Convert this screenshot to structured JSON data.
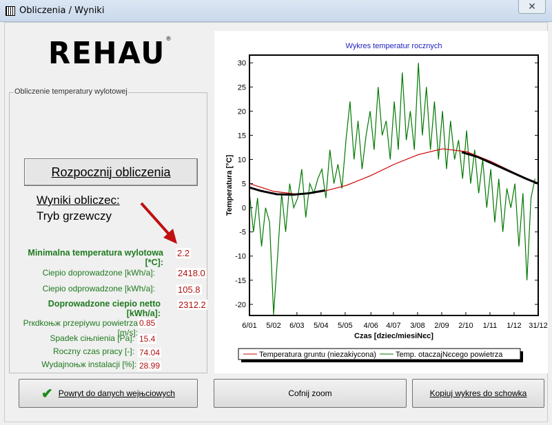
{
  "window": {
    "title": "Obliczenia / Wyniki",
    "close": "✕"
  },
  "logo": "REHAU",
  "group_label": "Obliczenie temperatury wylotowej",
  "start_button": "Rozpocznij obliczenia",
  "results_heading": "Wyniki obliczec:",
  "mode": "Tryb grzewczy",
  "results": [
    {
      "label": "Minimalna temperatura wylotowa [*C]:",
      "value": "2.2"
    },
    {
      "label": "Ciepio doprowadzone [kWh/a]:",
      "value": "2418.0"
    },
    {
      "label": "Ciepio odprowadzone  [kWh/a]:",
      "value": "105.8"
    },
    {
      "label": "Doprowadzone ciepio netto [kWh/a]:",
      "value": "2312.2"
    },
    {
      "label": "Prкdkoњж przepiywu powietrza [m/s]:",
      "value": "0.85"
    },
    {
      "label": "Spadek ciњnienia [Pa]:",
      "value": "15.4"
    },
    {
      "label": "Roczny czas pracy [-]:",
      "value": "74.04"
    },
    {
      "label": "Wydajnoњж instalacji [%]:",
      "value": "28.99"
    }
  ],
  "buttons": {
    "back": "Powrуt do danych wejњciowych",
    "unzoom": "Cofnij zoom",
    "copy": "Kopiuj wykres do schowka"
  },
  "colors": {
    "ground": "#cc0000",
    "air": "#007700",
    "outlet": "#000000",
    "title": "#2020c0"
  },
  "chart_data": {
    "type": "line",
    "title": "Wykres temperatur rocznych",
    "xlabel": "Czas [dziec/miesiNєc]",
    "ylabel": "Temperatura [°C]",
    "xlim": [
      6,
      365
    ],
    "ylim": [
      -22.3,
      31.6
    ],
    "yticks": [
      -20,
      -15,
      -10,
      -5,
      0,
      5,
      10,
      15,
      20,
      25,
      30
    ],
    "xticks": [
      {
        "day": 6,
        "label": "6/01"
      },
      {
        "day": 36,
        "label": "5/02"
      },
      {
        "day": 65,
        "label": "6/03"
      },
      {
        "day": 95,
        "label": "5/04"
      },
      {
        "day": 125,
        "label": "5/05"
      },
      {
        "day": 157,
        "label": "4/06"
      },
      {
        "day": 185,
        "label": "4/07"
      },
      {
        "day": 215,
        "label": "3/08"
      },
      {
        "day": 245,
        "label": "2/09"
      },
      {
        "day": 275,
        "label": "2/10"
      },
      {
        "day": 305,
        "label": "1/11"
      },
      {
        "day": 335,
        "label": "1/12"
      },
      {
        "day": 365,
        "label": "31/12"
      }
    ],
    "legend": [
      "Temperatura gruntu (niezakiycona)",
      "Temp. otaczajNєcego powietrza"
    ],
    "legend_position": "bottom",
    "series": [
      {
        "name": "Temperatura gruntu (niezakiycona)",
        "x": [
          6,
          36,
          66,
          96,
          126,
          156,
          186,
          216,
          246,
          276,
          306,
          336,
          365
        ],
        "y": [
          5,
          3.4,
          2.8,
          3.3,
          4.6,
          6.6,
          9,
          11,
          12.2,
          11.6,
          9.6,
          7.2,
          5
        ]
      },
      {
        "name": "Temp. otaczajNєcego powietrza",
        "step_days": 5,
        "y": [
          3,
          -5,
          2,
          -8,
          0,
          -3,
          -22,
          -10,
          3,
          -5,
          5,
          0,
          2,
          8,
          -2,
          5,
          3,
          6,
          8,
          2,
          12,
          5,
          9,
          4,
          14,
          22,
          10,
          18,
          8,
          15,
          20,
          12,
          25,
          15,
          18,
          10,
          22,
          12,
          28,
          14,
          20,
          12,
          30,
          15,
          25,
          12,
          22,
          10,
          20,
          8,
          18,
          10,
          14,
          6,
          16,
          5,
          12,
          3,
          10,
          0,
          8,
          -3,
          6,
          -5,
          4,
          0,
          5,
          -8,
          3,
          -15,
          2,
          6
        ]
      },
      {
        "name": "",
        "x": [
          6,
          20,
          40,
          60,
          80,
          100,
          270,
          290,
          310,
          330,
          350,
          365
        ],
        "y": [
          4.2,
          3.5,
          2.8,
          2.7,
          3.0,
          3.6,
          11.5,
          10.5,
          9,
          7.5,
          6,
          5
        ]
      }
    ]
  }
}
